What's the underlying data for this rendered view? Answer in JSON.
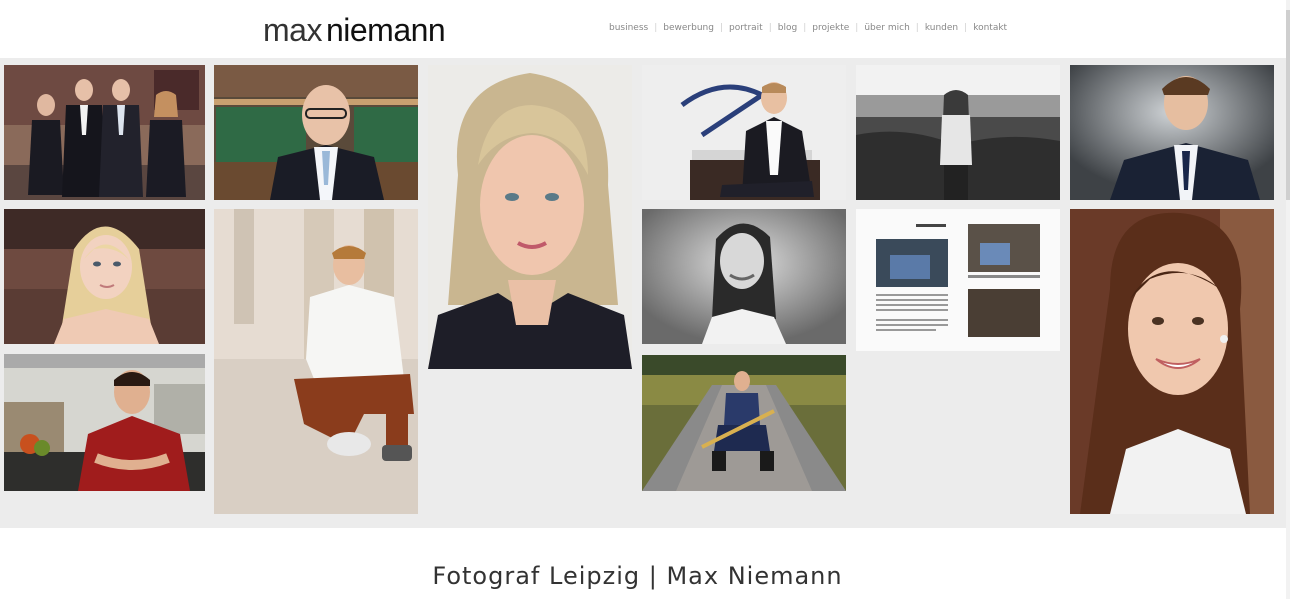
{
  "header": {
    "logo_part1": "max",
    "logo_part2": "niemann",
    "nav": [
      "business",
      "bewerbung",
      "portrait",
      "blog",
      "projekte",
      "über mich",
      "kunden",
      "kontakt"
    ]
  },
  "footer": {
    "tagline": "Fotograf Leipzig | Max Niemann"
  },
  "colors": {
    "background": "#ffffff",
    "gallery": "#ececec",
    "text": "#333333"
  },
  "gallery": [
    {
      "name": "photo-business-team"
    },
    {
      "name": "photo-man-library"
    },
    {
      "name": "photo-blonde-woman-portrait"
    },
    {
      "name": "photo-man-armchair"
    },
    {
      "name": "photo-woman-field-bw"
    },
    {
      "name": "photo-young-man-suit"
    },
    {
      "name": "photo-young-woman-blonde"
    },
    {
      "name": "photo-young-man-sitting"
    },
    {
      "name": "photo-woman-smiling-bw"
    },
    {
      "name": "photo-magazine-spread"
    },
    {
      "name": "photo-brunette-woman-smiling"
    },
    {
      "name": "photo-chef-kitchen"
    },
    {
      "name": "photo-trumpet-player-road"
    }
  ]
}
